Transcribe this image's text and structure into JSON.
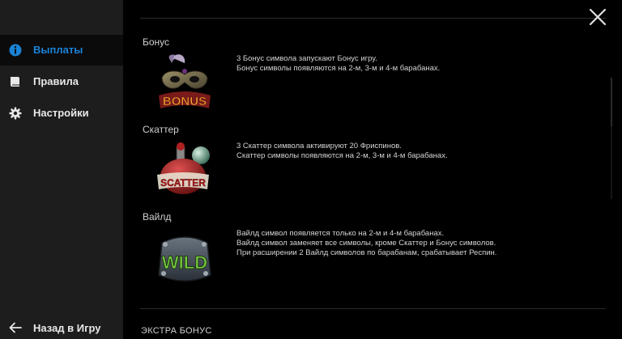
{
  "sidebar": {
    "items": [
      {
        "label": "Выплаты",
        "icon": "info-icon"
      },
      {
        "label": "Правила",
        "icon": "book-icon"
      },
      {
        "label": "Настройки",
        "icon": "gear-icon"
      }
    ],
    "back_label": "Назад в Игру"
  },
  "colors": {
    "accent": "#1a82d6",
    "sidebar_bg": "#1d1d1d",
    "content_bg": "#000000"
  },
  "sections": [
    {
      "title": "Бонус",
      "symbol_label": "BONUS",
      "lines": [
        "3 Бонус символа запускают Бонус игру.",
        "Бонус символы появляются на 2-м, 3-м и 4-м барабанах."
      ]
    },
    {
      "title": "Скаттер",
      "symbol_label": "SCATTER",
      "lines": [
        "3 Скаттер символа активируют 20 Фриспинов.",
        "Скаттер символы появляются на 2-м, 3-м и 4-м барабанах."
      ]
    },
    {
      "title": "Вайлд",
      "symbol_label": "WILD",
      "lines": [
        "Вайлд символ появляется только на 2-м и 4-м барабанах.",
        "Вайлд символ заменяет все символы, кроме Скаттер и Бонус символов.",
        "При расширении 2 Вайлд символов по барабанам, срабатывает Респин."
      ]
    }
  ],
  "extra_bonus_title": "ЭКСТРА БОНУС"
}
